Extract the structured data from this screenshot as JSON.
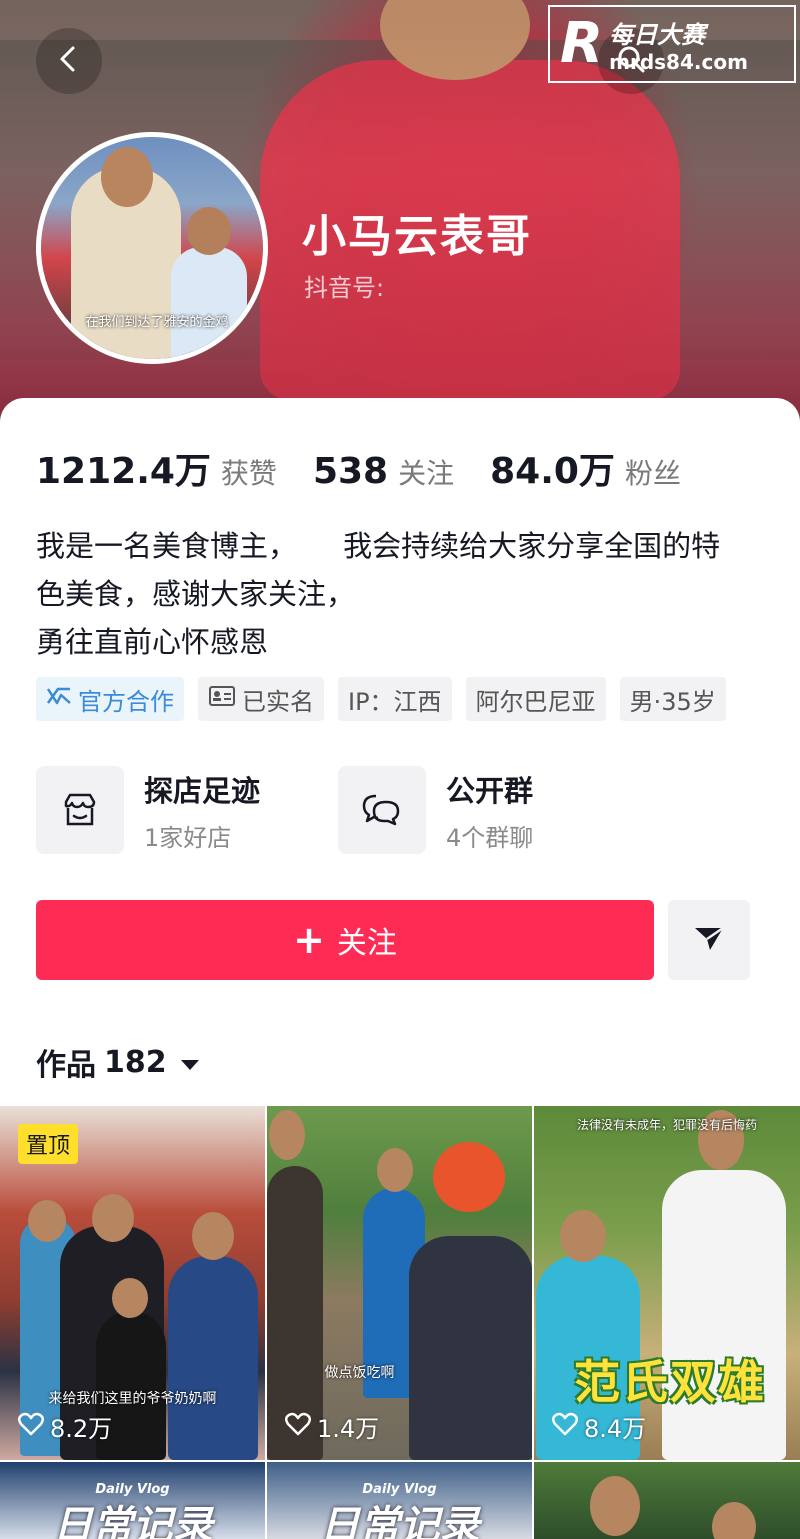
{
  "watermark": {
    "brand": "每日大赛",
    "url": "mrds84.com",
    "logo": "R"
  },
  "profile": {
    "name": "小马云表哥",
    "douyin_id_label": "抖音号:",
    "avatar_caption": "在我们到达了雅安的金鸡"
  },
  "stats": [
    {
      "value": "1212.4万",
      "label": "获赞"
    },
    {
      "value": "538",
      "label": "关注"
    },
    {
      "value": "84.0万",
      "label": "粉丝"
    }
  ],
  "bio": {
    "line1": "我是一名美食博主，     我会持续给大家分享全国的特",
    "line2": "色美食，感谢大家关注，",
    "line3": "勇往直前心怀感恩"
  },
  "tags": {
    "official": "官方合作",
    "verified": "已实名",
    "ip": "IP：江西",
    "location": "阿尔巴尼亚",
    "gender_age": "男·35岁"
  },
  "entries": {
    "shop": {
      "title": "探店足迹",
      "sub": "1家好店"
    },
    "group": {
      "title": "公开群",
      "sub": "4个群聊"
    }
  },
  "actions": {
    "follow": "关注",
    "follow_plus": "+"
  },
  "works": {
    "label": "作品",
    "count": "182"
  },
  "videos": [
    {
      "pinned": "置顶",
      "likes": "8.2万",
      "subtitle": "来给我们这里的爷爷奶奶啊"
    },
    {
      "likes": "1.4万",
      "subtitle": "做点饭吃啊"
    },
    {
      "likes": "8.4万",
      "caption": "范氏双雄",
      "top_caption": "法律没有未成年，犯罪没有后悔药"
    },
    {
      "vlog_en": "Daily Vlog",
      "vlog_cn": "日常记录"
    },
    {
      "vlog_en": "Daily Vlog",
      "vlog_cn": "日常记录"
    },
    {}
  ],
  "icons": {
    "back": "chevron-left-icon",
    "search": "search-icon",
    "share": "send-icon",
    "shop": "store-icon",
    "group": "chat-bubbles-icon",
    "heart": "heart-icon",
    "official": "official-partner-icon",
    "idcard": "id-card-icon",
    "caret": "caret-down-icon"
  },
  "colors": {
    "accent": "#fe2c55",
    "pinned": "#ffdf2c",
    "official": "#3a8bd8",
    "text": "#161823"
  }
}
